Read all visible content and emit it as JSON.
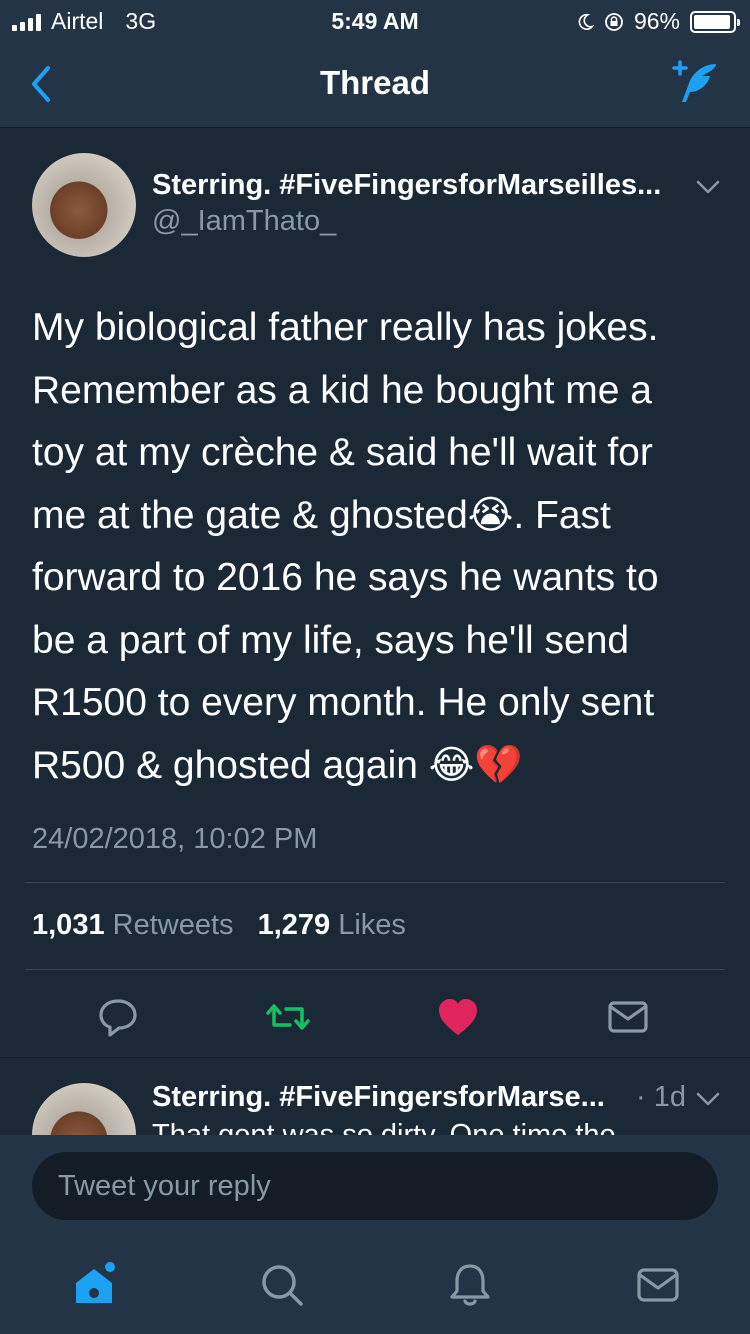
{
  "status_bar": {
    "carrier": "Airtel",
    "network": "3G",
    "time": "5:49 AM",
    "battery": "96%",
    "battery_level": 0.96
  },
  "nav": {
    "title": "Thread",
    "back_icon": "chevron-left-icon",
    "compose_icon": "compose-tweet-icon"
  },
  "tweet": {
    "author_name": "Sterring. #FiveFingersforMarseilles...",
    "handle": "@_IamThato_",
    "text": "My biological father really has jokes.\nRemember as a kid he bought me a\ntoy at my crèche & said he'll wait for\nme at the gate & ghosted😭. Fast\nforward to 2016 he says he wants to\nbe a part of my life, says he'll send\nR1500 to every month. He only sent\nR500 & ghosted again 😂💔",
    "date": "24/02/2018, 10:02 PM",
    "retweets_count": "1,031",
    "retweets_label": "Retweets",
    "likes_count": "1,279",
    "likes_label": "Likes",
    "liked": true
  },
  "preview": {
    "author_name": "Sterring. #FiveFingersforMarse...",
    "time": "· 1d",
    "text": "That gent was so dirty. One time the"
  },
  "reply": {
    "placeholder": "Tweet your reply"
  },
  "colors": {
    "background": "#1b2836",
    "bar": "#243447",
    "accent": "#1da1f2",
    "retweet": "#17bf63",
    "like": "#e0245e",
    "muted": "#8899a6"
  },
  "tabs": [
    "home-icon",
    "search-icon",
    "notifications-icon",
    "messages-icon"
  ]
}
